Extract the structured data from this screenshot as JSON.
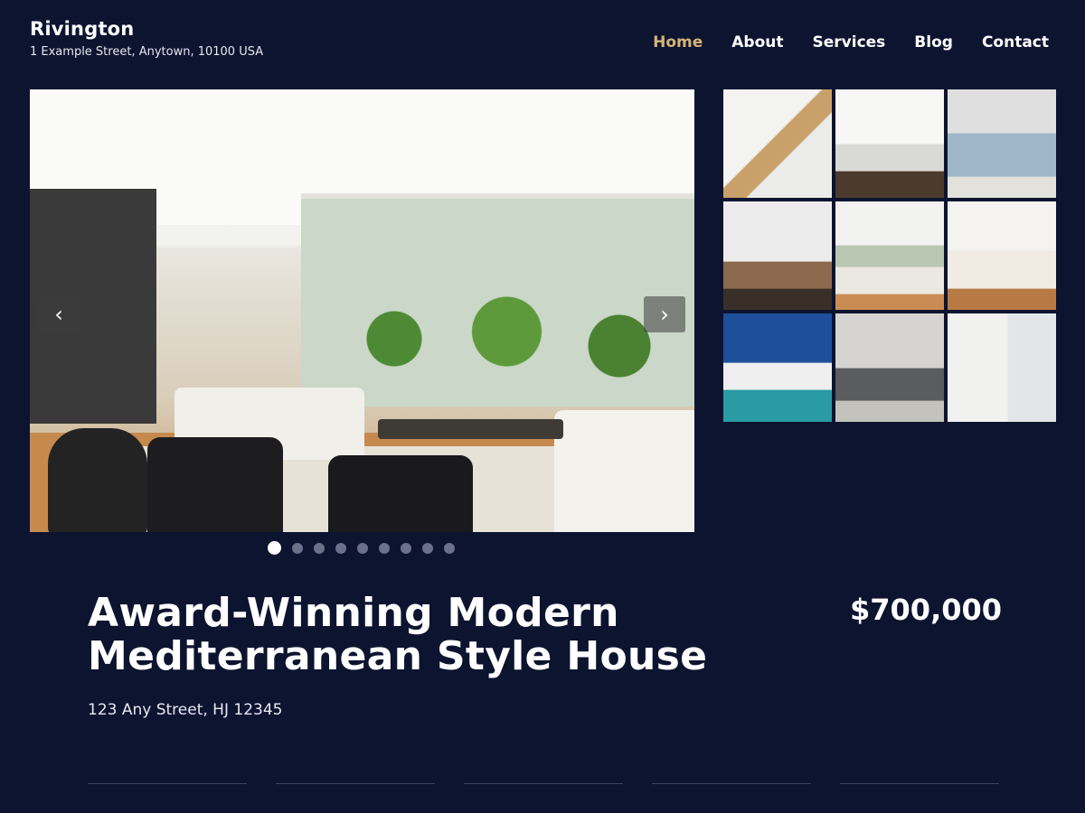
{
  "header": {
    "brand_name": "Rivington",
    "brand_address": "1 Example Street, Anytown, 10100 USA",
    "nav": [
      {
        "label": "Home",
        "active": true
      },
      {
        "label": "About",
        "active": false
      },
      {
        "label": "Services",
        "active": false
      },
      {
        "label": "Blog",
        "active": false
      },
      {
        "label": "Contact",
        "active": false
      }
    ],
    "active_color": "#d6b476"
  },
  "gallery": {
    "prev_icon": "chevron-left-icon",
    "next_icon": "chevron-right-icon",
    "prev_glyph": "‹",
    "next_glyph": "›",
    "total_slides": 9,
    "current_slide": 1
  },
  "listing": {
    "title_line1": "Award-Winning Modern",
    "title_line2": "Mediterranean Style House",
    "address": "123 Any Street, HJ 12345",
    "price": "$700,000"
  },
  "colors": {
    "background": "#0c1430",
    "text": "#ffffff"
  }
}
